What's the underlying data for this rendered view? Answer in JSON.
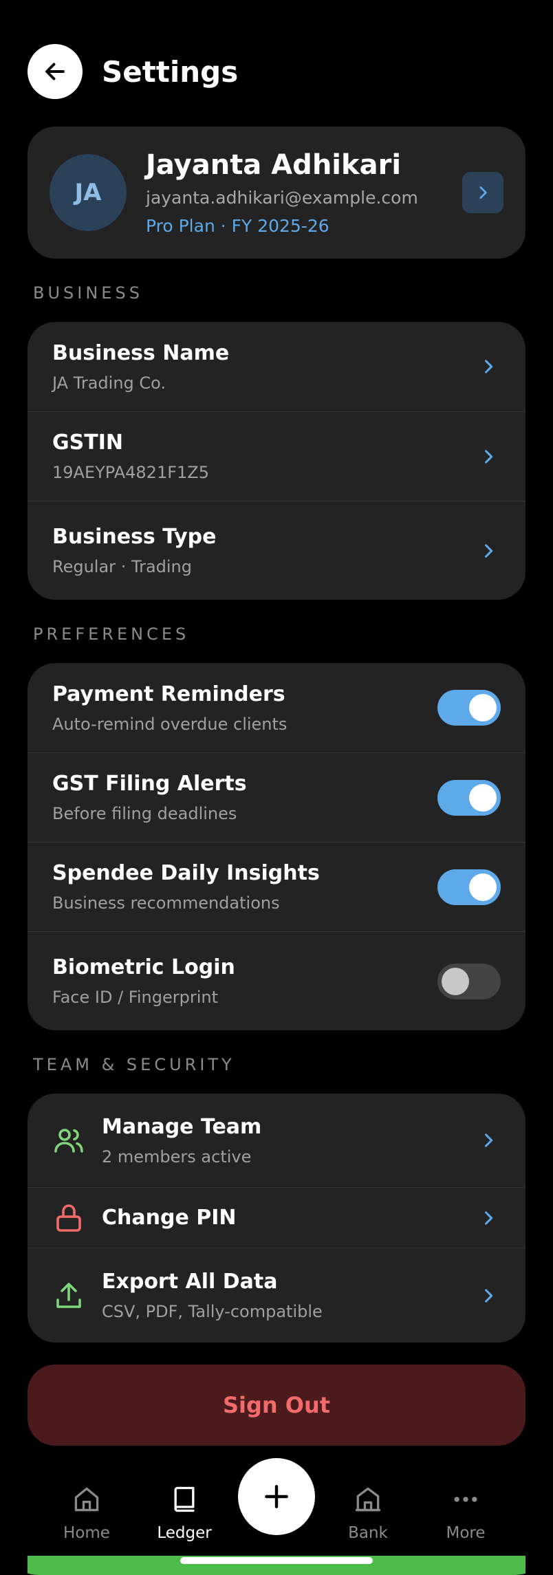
{
  "header": {
    "title": "Settings"
  },
  "profile": {
    "initials": "JA",
    "name": "Jayanta Adhikari",
    "email": "jayanta.adhikari@example.com",
    "plan": "Pro Plan · FY 2025-26"
  },
  "sections": {
    "business": "BUSINESS",
    "preferences": "PREFERENCES",
    "team_security": "TEAM & SECURITY"
  },
  "business": {
    "name_title": "Business Name",
    "name_value": "JA Trading Co.",
    "gstin_title": "GSTIN",
    "gstin_value": "19AEYPA4821F1Z5",
    "type_title": "Business Type",
    "type_value": "Regular · Trading"
  },
  "preferences": {
    "reminders_title": "Payment Reminders",
    "reminders_sub": "Auto-remind overdue clients",
    "reminders_on": true,
    "gst_title": "GST Filing Alerts",
    "gst_sub": "Before filing deadlines",
    "gst_on": true,
    "insights_title": "Spendee Daily Insights",
    "insights_sub": "Business recommendations",
    "insights_on": true,
    "biometric_title": "Biometric Login",
    "biometric_sub": "Face ID / Fingerprint",
    "biometric_on": false
  },
  "team": {
    "manage_title": "Manage Team",
    "manage_sub": "2 members active",
    "pin_title": "Change PIN",
    "export_title": "Export All Data",
    "export_sub": "CSV, PDF, Tally-compatible"
  },
  "signout_label": "Sign Out",
  "nav": {
    "home": "Home",
    "ledger": "Ledger",
    "bank": "Bank",
    "more": "More"
  },
  "colors": {
    "accent": "#5da9e9",
    "card": "#232323",
    "danger": "#f26b6b",
    "success": "#4cbb4a"
  },
  "icons": {
    "back": "arrow-left-icon",
    "chevron": "chevron-right-icon",
    "team": "users-icon",
    "pin": "lock-icon",
    "export": "upload-icon",
    "home": "house-icon",
    "ledger": "book-icon",
    "add": "plus-icon",
    "bank": "bank-icon",
    "more": "more-dots-icon"
  }
}
